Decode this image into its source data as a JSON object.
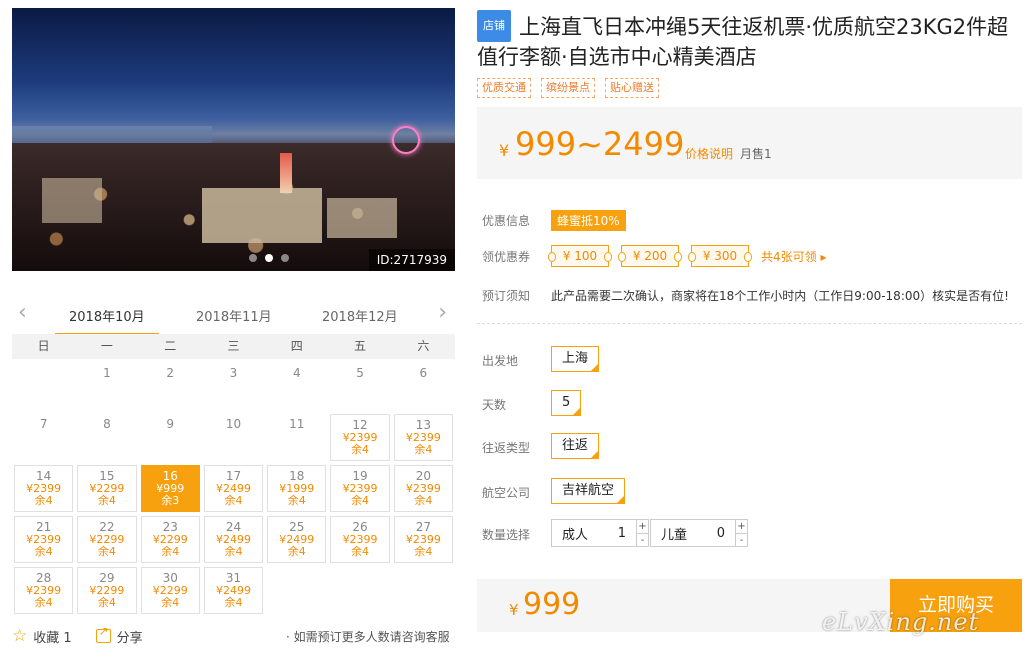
{
  "gallery": {
    "image_id": "ID:2717939",
    "dot_count": 3,
    "active_dot": 1
  },
  "calendar": {
    "months": [
      "2018年10月",
      "2018年11月",
      "2018年12月"
    ],
    "active_month": 0,
    "prev_icon": "chevron-left-icon",
    "next_icon": "chevron-right-icon",
    "weekdays": [
      "日",
      "一",
      "二",
      "三",
      "四",
      "五",
      "六"
    ],
    "days": [
      {
        "d": "",
        "p": "",
        "l": ""
      },
      {
        "d": "1",
        "p": "",
        "l": ""
      },
      {
        "d": "2",
        "p": "",
        "l": ""
      },
      {
        "d": "3",
        "p": "",
        "l": ""
      },
      {
        "d": "4",
        "p": "",
        "l": ""
      },
      {
        "d": "5",
        "p": "",
        "l": ""
      },
      {
        "d": "6",
        "p": "",
        "l": ""
      },
      {
        "d": "7",
        "p": "",
        "l": ""
      },
      {
        "d": "8",
        "p": "",
        "l": ""
      },
      {
        "d": "9",
        "p": "",
        "l": ""
      },
      {
        "d": "10",
        "p": "",
        "l": ""
      },
      {
        "d": "11",
        "p": "",
        "l": ""
      },
      {
        "d": "12",
        "p": "¥2399",
        "l": "余4"
      },
      {
        "d": "13",
        "p": "¥2399",
        "l": "余4"
      },
      {
        "d": "14",
        "p": "¥2399",
        "l": "余4"
      },
      {
        "d": "15",
        "p": "¥2299",
        "l": "余4"
      },
      {
        "d": "16",
        "p": "¥999",
        "l": "余3",
        "selected": true
      },
      {
        "d": "17",
        "p": "¥2499",
        "l": "余4"
      },
      {
        "d": "18",
        "p": "¥1999",
        "l": "余4"
      },
      {
        "d": "19",
        "p": "¥2399",
        "l": "余4"
      },
      {
        "d": "20",
        "p": "¥2399",
        "l": "余4"
      },
      {
        "d": "21",
        "p": "¥2399",
        "l": "余4"
      },
      {
        "d": "22",
        "p": "¥2299",
        "l": "余4"
      },
      {
        "d": "23",
        "p": "¥2299",
        "l": "余4"
      },
      {
        "d": "24",
        "p": "¥2499",
        "l": "余4"
      },
      {
        "d": "25",
        "p": "¥2499",
        "l": "余4"
      },
      {
        "d": "26",
        "p": "¥2399",
        "l": "余4"
      },
      {
        "d": "27",
        "p": "¥2399",
        "l": "余4"
      },
      {
        "d": "28",
        "p": "¥2399",
        "l": "余4"
      },
      {
        "d": "29",
        "p": "¥2299",
        "l": "余4"
      },
      {
        "d": "30",
        "p": "¥2299",
        "l": "余4"
      },
      {
        "d": "31",
        "p": "¥2499",
        "l": "余4"
      }
    ]
  },
  "footer": {
    "favorite_label": "收藏 1",
    "share_label": "分享",
    "note": "· 如需预订更多人数请咨询客服"
  },
  "product": {
    "shop_badge": "店铺",
    "title": "上海直飞日本冲绳5天往返机票·优质航空23KG2件超值行李额·自选市中心精美酒店",
    "tags": [
      "优质交通",
      "缤纷景点",
      "贴心赠送"
    ],
    "currency": "¥",
    "price_range": "999~2499",
    "price_explain": "价格说明",
    "monthly_sales": "月售1"
  },
  "promo": {
    "discount_label": "优惠信息",
    "discount_value": "蜂蜜抵10%",
    "coupon_label": "领优惠券",
    "coupons": [
      "¥ 100",
      "¥ 200",
      "¥ 300"
    ],
    "coupon_count": "共4张可领 ▸",
    "notice_label": "预订须知",
    "notice_text": "此产品需要二次确认，商家将在18个工作小时内（工作日9:00-18:00）核实是否有位!"
  },
  "options": {
    "departure_label": "出发地",
    "departure_value": "上海",
    "days_label": "天数",
    "days_value": "5",
    "trip_label": "往返类型",
    "trip_value": "往返",
    "airline_label": "航空公司",
    "airline_value": "吉祥航空",
    "quantity_label": "数量选择",
    "adult_label": "成人",
    "adult_value": "1",
    "child_label": "儿童",
    "child_value": "0",
    "plus": "+",
    "minus": "-"
  },
  "checkout": {
    "currency": "¥",
    "total": "999",
    "buy_label": "立即购买"
  },
  "watermark": "eLvXing.net"
}
